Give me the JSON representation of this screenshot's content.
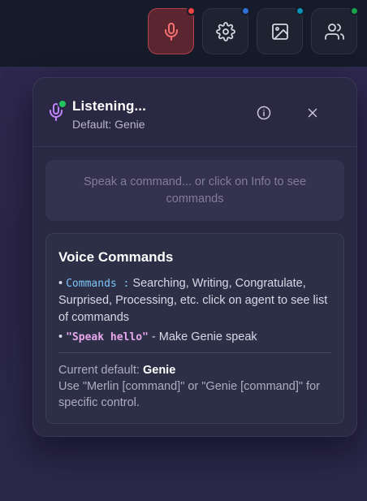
{
  "toolbar": {
    "buttons": [
      {
        "icon": "microphone-icon",
        "dot_color": "#ef4444",
        "active": true
      },
      {
        "icon": "gear-icon",
        "dot_color": "#2f6fd6"
      },
      {
        "icon": "image-icon",
        "dot_color": "#0891b2"
      },
      {
        "icon": "users-icon",
        "dot_color": "#16a34a"
      }
    ]
  },
  "panel": {
    "title": "Listening...",
    "subtitle": "Default: Genie",
    "status_dot_color": "#22c55e",
    "transcript_placeholder": "Speak a command... or click on Info to see commands"
  },
  "commands": {
    "title": "Voice Commands",
    "items": [
      {
        "bullet": "•",
        "code": "Commands :",
        "text": "Searching, Writing, Congratulate, Surprised, Processing, etc. click on agent to see list of commands"
      },
      {
        "bullet": "•",
        "code": "\"Speak hello\"",
        "text": "- Make Genie speak"
      }
    ],
    "footer_prefix": "Current default:",
    "footer_default": "Genie",
    "footer_text": "Use \"Merlin [command]\" or \"Genie [command]\" for specific control."
  }
}
